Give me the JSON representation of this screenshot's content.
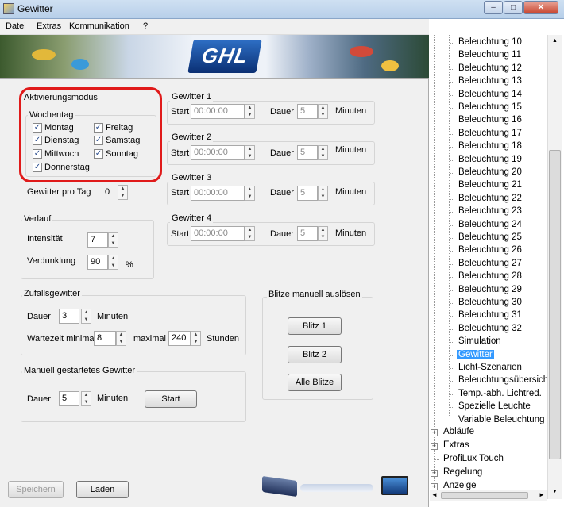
{
  "window": {
    "title": "Gewitter"
  },
  "menu": [
    "Datei",
    "Extras",
    "Kommunikation",
    "?"
  ],
  "banner": {
    "logo": "GHL"
  },
  "aktivierung": {
    "title": "Aktivierungsmodus",
    "wochentag_label": "Wochentag",
    "days": [
      {
        "label": "Montag",
        "checked": true
      },
      {
        "label": "Dienstag",
        "checked": true
      },
      {
        "label": "Mittwoch",
        "checked": true
      },
      {
        "label": "Donnerstag",
        "checked": true
      },
      {
        "label": "Freitag",
        "checked": true
      },
      {
        "label": "Samstag",
        "checked": true
      },
      {
        "label": "Sonntag",
        "checked": true
      }
    ],
    "check_glyph": "✓",
    "gewitter_pro_tag_label": "Gewitter pro Tag",
    "gewitter_pro_tag": "0"
  },
  "gewitter": [
    {
      "title": "Gewitter 1",
      "start_label": "Start",
      "start": "00:00:00",
      "dauer_label": "Dauer",
      "dauer": "5",
      "unit": "Minuten"
    },
    {
      "title": "Gewitter 2",
      "start_label": "Start",
      "start": "00:00:00",
      "dauer_label": "Dauer",
      "dauer": "5",
      "unit": "Minuten"
    },
    {
      "title": "Gewitter 3",
      "start_label": "Start",
      "start": "00:00:00",
      "dauer_label": "Dauer",
      "dauer": "5",
      "unit": "Minuten"
    },
    {
      "title": "Gewitter 4",
      "start_label": "Start",
      "start": "00:00:00",
      "dauer_label": "Dauer",
      "dauer": "5",
      "unit": "Minuten"
    }
  ],
  "verlauf": {
    "title": "Verlauf",
    "intensitaet_label": "Intensität",
    "intensitaet": "7",
    "verdunklung_label": "Verdunklung",
    "verdunklung": "90",
    "unit": "%"
  },
  "zufall": {
    "title": "Zufallsgewitter",
    "dauer_label": "Dauer",
    "dauer": "3",
    "dauer_unit": "Minuten",
    "wartezeit_label": "Wartezeit minimal",
    "min": "8",
    "max_label": "maximal",
    "max": "240",
    "max_unit": "Stunden"
  },
  "manuell": {
    "title": "Manuell gestartetes Gewitter",
    "dauer_label": "Dauer",
    "dauer": "5",
    "unit": "Minuten",
    "start_button": "Start"
  },
  "blitze": {
    "title": "Blitze manuell auslösen",
    "blitz1": "Blitz 1",
    "blitz2": "Blitz 2",
    "alle": "Alle Blitze"
  },
  "bottom": {
    "save": "Speichern",
    "load": "Laden"
  },
  "tree": {
    "leaves": [
      "Beleuchtung 10",
      "Beleuchtung 11",
      "Beleuchtung 12",
      "Beleuchtung 13",
      "Beleuchtung 14",
      "Beleuchtung 15",
      "Beleuchtung 16",
      "Beleuchtung 17",
      "Beleuchtung 18",
      "Beleuchtung 19",
      "Beleuchtung 20",
      "Beleuchtung 21",
      "Beleuchtung 22",
      "Beleuchtung 23",
      "Beleuchtung 24",
      "Beleuchtung 25",
      "Beleuchtung 26",
      "Beleuchtung 27",
      "Beleuchtung 28",
      "Beleuchtung 29",
      "Beleuchtung 30",
      "Beleuchtung 31",
      "Beleuchtung 32",
      "Simulation",
      "Gewitter",
      "Licht-Szenarien",
      "Beleuchtungsübersicht",
      "Temp.-abh. Lichtred.",
      "Spezielle Leuchte",
      "Variable Beleuchtung"
    ],
    "selected": "Gewitter",
    "roots": [
      {
        "label": "Abläufe",
        "expandable": true
      },
      {
        "label": "Extras",
        "expandable": true
      },
      {
        "label": "ProfiLux Touch",
        "expandable": false
      },
      {
        "label": "Regelung",
        "expandable": true
      },
      {
        "label": "Anzeige",
        "expandable": true
      }
    ],
    "plus_glyph": "+"
  },
  "colors": {
    "selection": "#3399ff",
    "highlight": "#e01a1a"
  }
}
